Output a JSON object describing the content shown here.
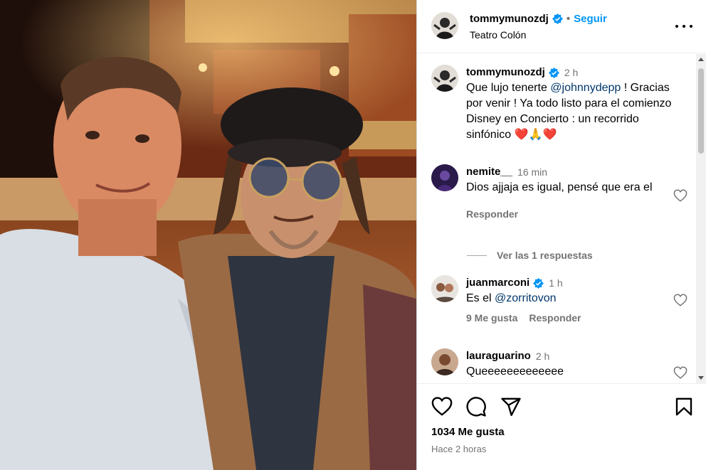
{
  "post": {
    "username": "tommymunozdj",
    "follow_label": "Seguir",
    "dot": "•",
    "location": "Teatro Colón"
  },
  "caption": {
    "username": "tommymunozdj",
    "time": "2 h",
    "text_before": "Que lujo tenerte ",
    "mention": "@johnnydepp",
    "text_after": " ! Gracias por venir ! Ya todo listo para el comienzo Disney en Concierto : un recorrido sinfónico ",
    "emojis": "❤️🙏❤️"
  },
  "comments": [
    {
      "username": "nemite__",
      "time": "16 min",
      "text": "Dios ajjaja es igual, pensé que era el",
      "reply_label": "Responder",
      "view_replies": "Ver las 1 respuestas"
    },
    {
      "username": "juanmarconi",
      "time": "1 h",
      "text_before": "Es el ",
      "mention": "@zorritovon",
      "likes_label": "9 Me gusta",
      "reply_label": "Responder"
    },
    {
      "username": "lauraguarino",
      "time": "2 h",
      "text": "Queeeeeeeeeeeee"
    }
  ],
  "footer": {
    "likes": "1034 Me gusta",
    "posted_ago": "Hace 2 horas"
  },
  "icons": {
    "like": "heart-icon",
    "comment": "comment-icon",
    "share": "share-icon",
    "save": "bookmark-icon",
    "more": "more-icon",
    "verified": "verified-badge-icon"
  },
  "colors": {
    "link_blue": "#0095f6",
    "mention": "#00376b",
    "secondary_text": "#737373",
    "heart_red": "#e0245e"
  }
}
